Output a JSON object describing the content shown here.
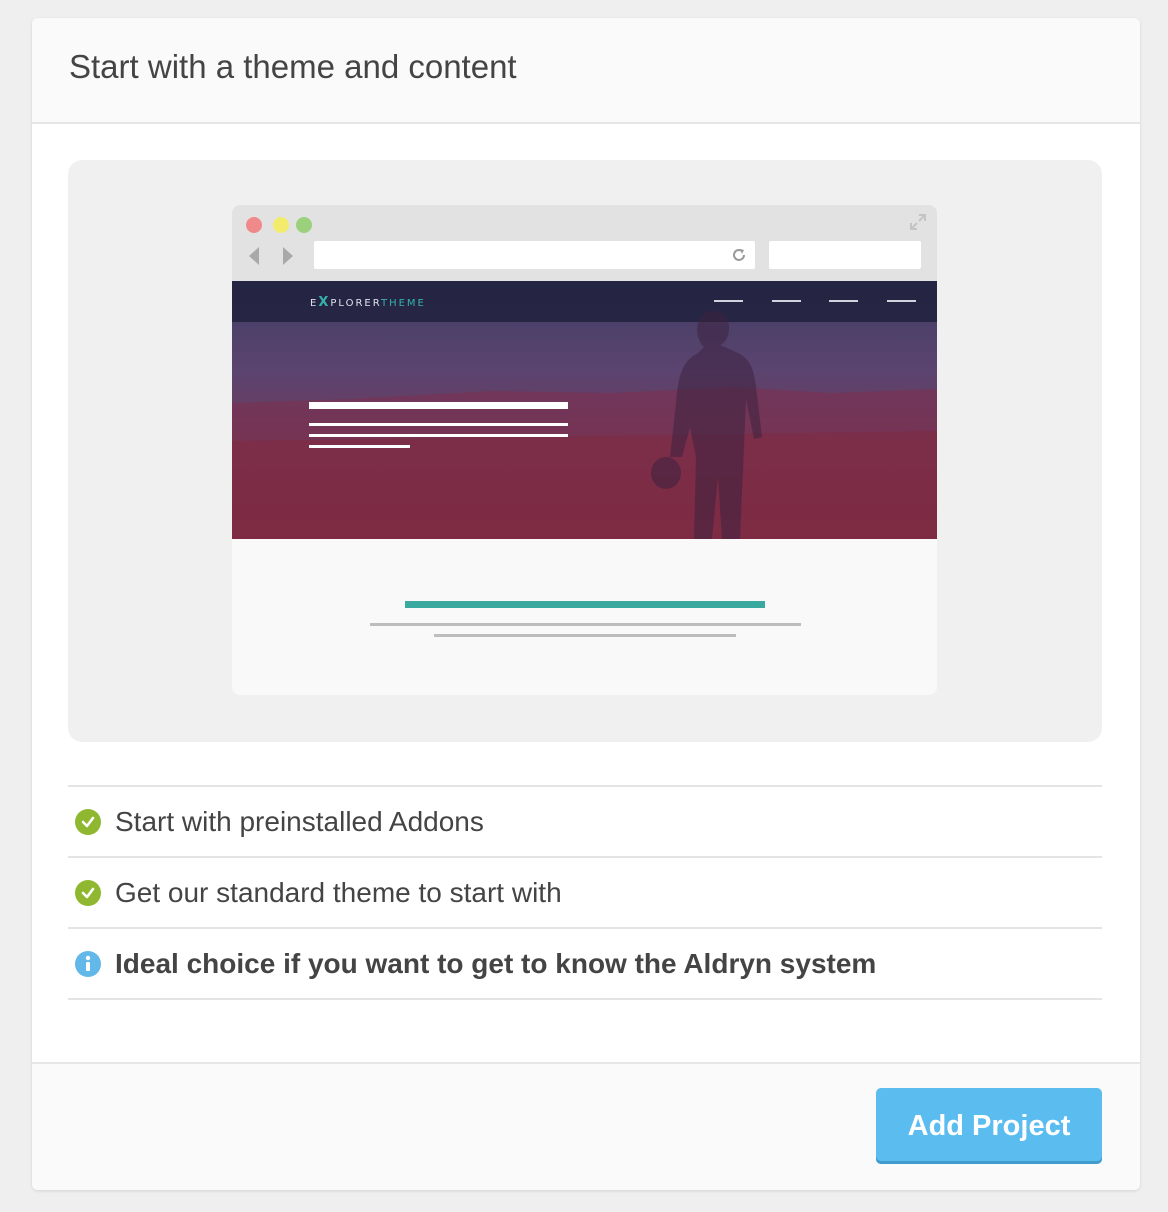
{
  "card": {
    "title": "Start with a theme and content"
  },
  "preview": {
    "browser_dots": [
      "red",
      "yellow",
      "green"
    ],
    "site_logo": {
      "prefix": "E",
      "x": "X",
      "middle": "PLORER",
      "accent": "THEME"
    },
    "nav_item_count": 4
  },
  "features": [
    {
      "icon": "check-circle-icon",
      "text": "Start with preinstalled Addons",
      "bold": false
    },
    {
      "icon": "check-circle-icon",
      "text": "Get our standard theme to start with",
      "bold": false
    },
    {
      "icon": "info-circle-icon",
      "text": "Ideal choice if you want to get to know the Aldryn system",
      "bold": true
    }
  ],
  "footer": {
    "add_button_label": "Add Project"
  },
  "colors": {
    "accent_button": "#5bbcf0",
    "check_green": "#8fb830",
    "info_blue": "#62b8e8",
    "teal": "#3aa99f"
  }
}
